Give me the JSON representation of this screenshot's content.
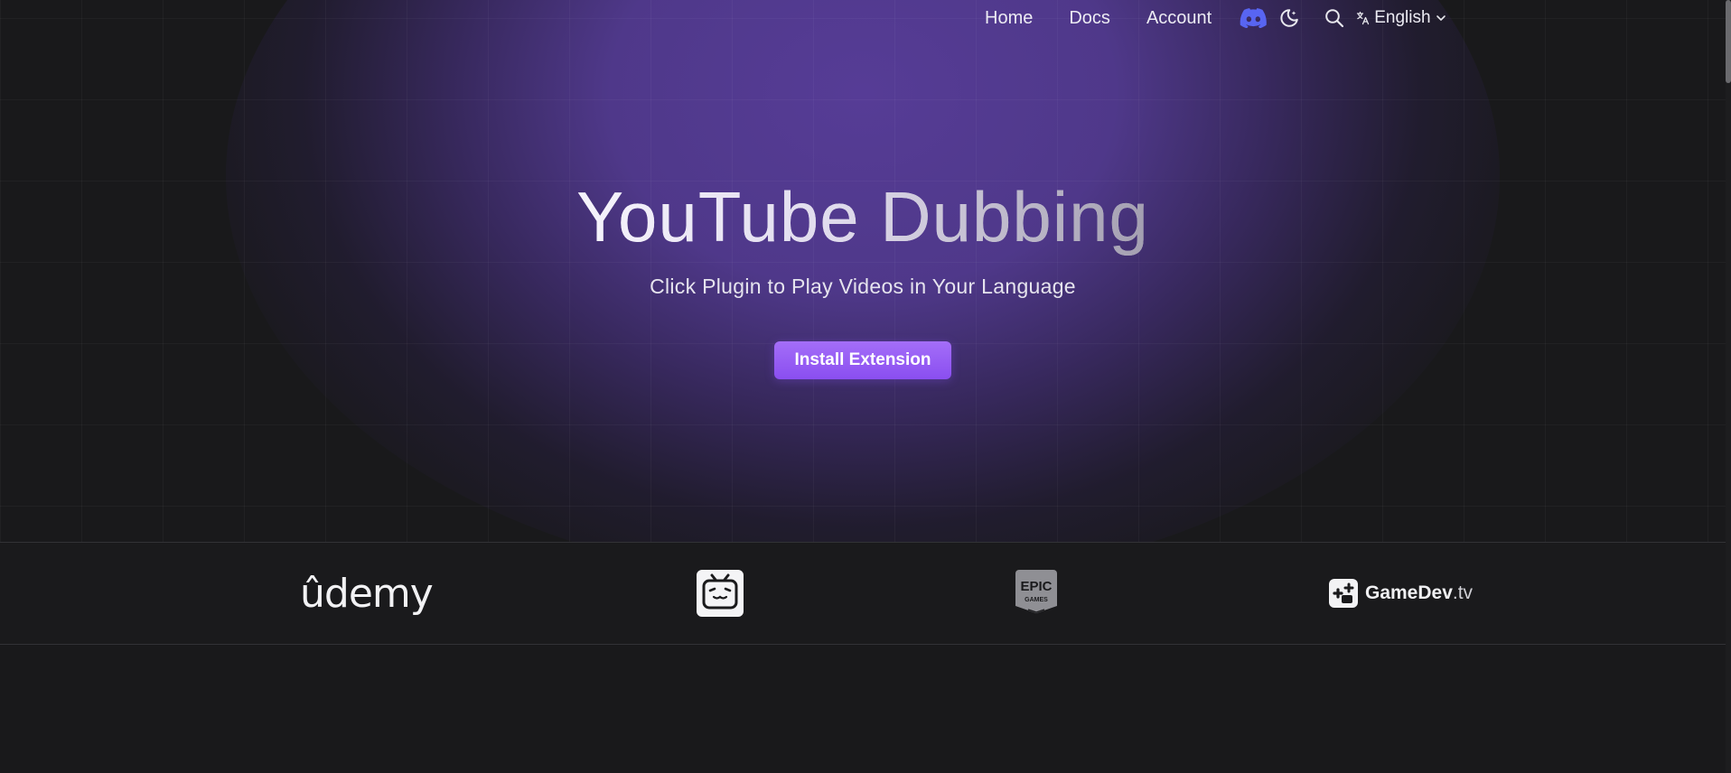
{
  "nav": {
    "links": [
      {
        "label": "Home"
      },
      {
        "label": "Docs"
      },
      {
        "label": "Account"
      }
    ],
    "icons": {
      "discord": "discord-icon",
      "theme": "moon-icon",
      "search": "search-icon",
      "language": "translate-icon"
    },
    "language_label": "English"
  },
  "hero": {
    "title": "YouTube Dubbing",
    "subtitle": "Click Plugin to Play Videos in Your Language",
    "cta_label": "Install Extension"
  },
  "partners": {
    "udemy": "ûdemy",
    "bilibili_icon": "bilibili-tv-icon",
    "epic": {
      "line1": "EPIC",
      "line2": "GAMES"
    },
    "gamedev": {
      "name": "GameDev",
      "suffix": ".tv"
    }
  },
  "colors": {
    "background": "#19191b",
    "glow": "#563c96",
    "accent": "#9b5ff6",
    "discord": "#5865f2"
  }
}
